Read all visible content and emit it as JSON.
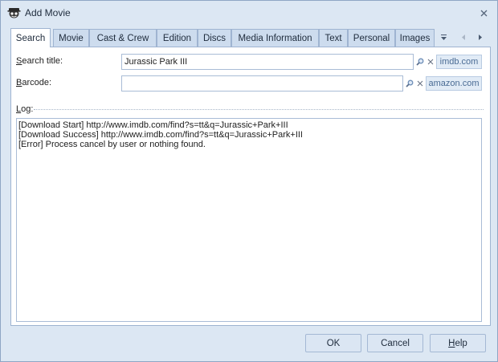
{
  "window": {
    "title": "Add Movie",
    "close_icon": "close-x-icon"
  },
  "tabs": [
    {
      "label": "Search",
      "active": true
    },
    {
      "label": "Movie"
    },
    {
      "label": "Cast & Crew"
    },
    {
      "label": "Edition"
    },
    {
      "label": "Discs"
    },
    {
      "label": "Media Information"
    },
    {
      "label": "Text"
    },
    {
      "label": "Personal"
    },
    {
      "label": "Images"
    }
  ],
  "tab_nav": {
    "menu_icon": "dropdown-arrow-icon",
    "prev_icon": "chevron-left-icon",
    "next_icon": "chevron-right-icon"
  },
  "search": {
    "title_label_pre": "",
    "title_label_u": "S",
    "title_label_post": "earch title:",
    "title_value": "Jurassic Park III",
    "title_provider": "imdb.com",
    "barcode_label_u": "B",
    "barcode_label_post": "arcode:",
    "barcode_value": "",
    "barcode_provider": "amazon.com"
  },
  "log": {
    "label_u": "L",
    "label_post": "og:",
    "lines": [
      "[Download Start] http://www.imdb.com/find?s=tt&q=Jurassic+Park+III",
      "[Download Success] http://www.imdb.com/find?s=tt&q=Jurassic+Park+III",
      "[Error] Process cancel by user or nothing found."
    ]
  },
  "buttons": {
    "ok": "OK",
    "cancel": "Cancel",
    "help_u": "H",
    "help_post": "elp"
  }
}
